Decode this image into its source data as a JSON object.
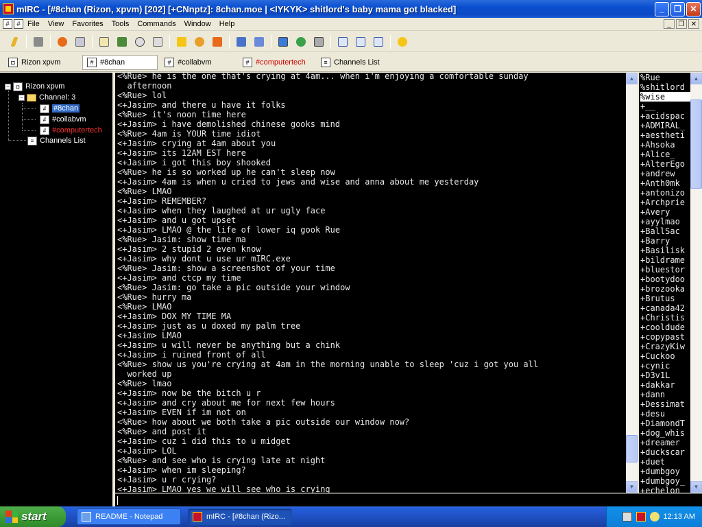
{
  "window": {
    "title": "mIRC - [#8chan (Rizon, xpvm) [202] [+CNnptz]: 8chan.moe | <IYKYK> shitlord's baby mama got blacked]"
  },
  "menu": {
    "items": [
      "File",
      "View",
      "Favorites",
      "Tools",
      "Commands",
      "Window",
      "Help"
    ]
  },
  "switchbar": {
    "items": [
      {
        "label": "Rizon xpvm",
        "icon": "server-icon"
      },
      {
        "label": "#8chan",
        "icon": "channel-icon"
      },
      {
        "label": "#collabvm",
        "icon": "channel-icon"
      },
      {
        "label": "#computertech",
        "icon": "channel-icon"
      },
      {
        "label": "Channels List",
        "icon": "list-icon"
      }
    ]
  },
  "tree": {
    "server": "Rizon xpvm",
    "folder": "Channel: 3",
    "channels": [
      "#8chan",
      "#collabvm",
      "#computertech"
    ],
    "list": "Channels List"
  },
  "chat": {
    "lines": [
      "<%Rue> he is the one that's crying at 4am... when i'm enjoying a comfortable sunday",
      "  afternoon",
      "<%Rue> lol",
      "<+Jasim> and there u have it folks",
      "<%Rue> it's noon time here",
      "<+Jasim> i have demolished chinese gooks mind",
      "<%Rue> 4am is YOUR time idiot",
      "<+Jasim> crying at 4am about you",
      "<+Jasim> its 12AM EST here",
      "<+Jasim> i got this boy shooked",
      "<%Rue> he is so worked up he can't sleep now",
      "<+Jasim> 4am is when u cried to jews and wise and anna about me yesterday",
      "<%Rue> LMAO",
      "<+Jasim> REMEMBER?",
      "<+Jasim> when they laughed at ur ugly face",
      "<+Jasim> and u got upset",
      "<+Jasim> LMAO @ the life of lower iq gook Rue",
      "<%Rue> Jasim: show time ma",
      "<+Jasim> 2 stupid 2 even know",
      "<+Jasim> why dont u use ur mIRC.exe",
      "<%Rue> Jasim: show a screenshot of your time",
      "<+Jasim> and ctcp my time",
      "<%Rue> Jasim: go take a pic outside your window",
      "<%Rue> hurry ma",
      "<%Rue> LMAO",
      "<+Jasim> DOX MY TIME MA",
      "<+Jasim> just as u doxed my palm tree",
      "<+Jasim> LMAO",
      "<+Jasim> u will never be anything but a chink",
      "<+Jasim> i ruined front of all",
      "<%Rue> show us you're crying at 4am in the morning unable to sleep 'cuz i got you all",
      "  worked up",
      "<%Rue> lmao",
      "<+Jasim> now be the bitch u r",
      "<+Jasim> and cry about me for next few hours",
      "<+Jasim> EVEN if im not on",
      "<%Rue> how about we both take a pic outside our window now?",
      "<%Rue> and post it",
      "<+Jasim> cuz i did this to u midget",
      "<+Jasim> LOL",
      "<%Rue> and see who is crying late at night",
      "<+Jasim> when im sleeping?",
      "<+Jasim> u r crying?",
      "<+Jasim> LMAO yes we will see who is crying"
    ],
    "scroll_position": 0.95
  },
  "nicklist": {
    "nicks": [
      "%Rue",
      "%shitlord",
      "%wise",
      "+__",
      "+acidspac",
      "+ADMIRAL_",
      "+aestheti",
      "+Ahsoka",
      "+Alice_",
      "+AlterEgo",
      "+andrew",
      "+Anth0mk",
      "+antonizo",
      "+Archprie",
      "+Avery",
      "+ayylmao",
      "+BallSac",
      "+Barry",
      "+Basilisk",
      "+bildrame",
      "+bluestor",
      "+bootydoo",
      "+brozooka",
      "+Brutus",
      "+canada42",
      "+Christis",
      "+cooldude",
      "+copypast",
      "+CrazyKiw",
      "+Cuckoo",
      "+cynic",
      "+D3v1L",
      "+dakkar",
      "+dann",
      "+Dessimat",
      "+desu",
      "+DiamondT",
      "+dog_whis",
      "+dreamer",
      "+duckscar",
      "+duet",
      "+dumbgoy",
      "+dumbgoy_",
      "+echelon"
    ],
    "selected": "%wise",
    "scroll_position": 0.05
  },
  "taskbar": {
    "start": "start",
    "tasks": [
      {
        "label": "README - Notepad",
        "icon": "notepad-icon"
      },
      {
        "label": "mIRC - [#8chan (Rizo...",
        "icon": "mirc-icon"
      }
    ],
    "clock": "12:13 AM"
  }
}
